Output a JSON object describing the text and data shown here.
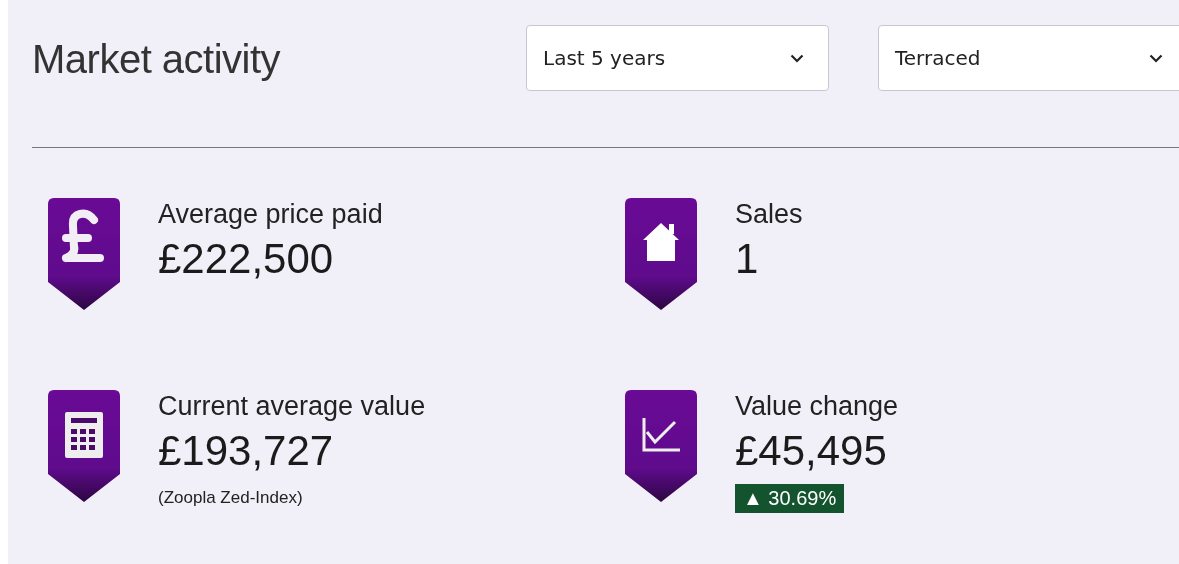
{
  "title": "Market activity",
  "filters": [
    {
      "value": "Last 5 years"
    },
    {
      "value": "Terraced"
    }
  ],
  "stats": [
    {
      "label": "Average price paid",
      "value": "£222,500"
    },
    {
      "label": "Sales",
      "value": "1"
    },
    {
      "label": "Current average value",
      "value": "£193,727",
      "note": "(Zoopla Zed-Index)"
    },
    {
      "label": "Value change",
      "value": "£45,495",
      "change": {
        "arrow": "▲",
        "text": "30.69%"
      }
    }
  ]
}
